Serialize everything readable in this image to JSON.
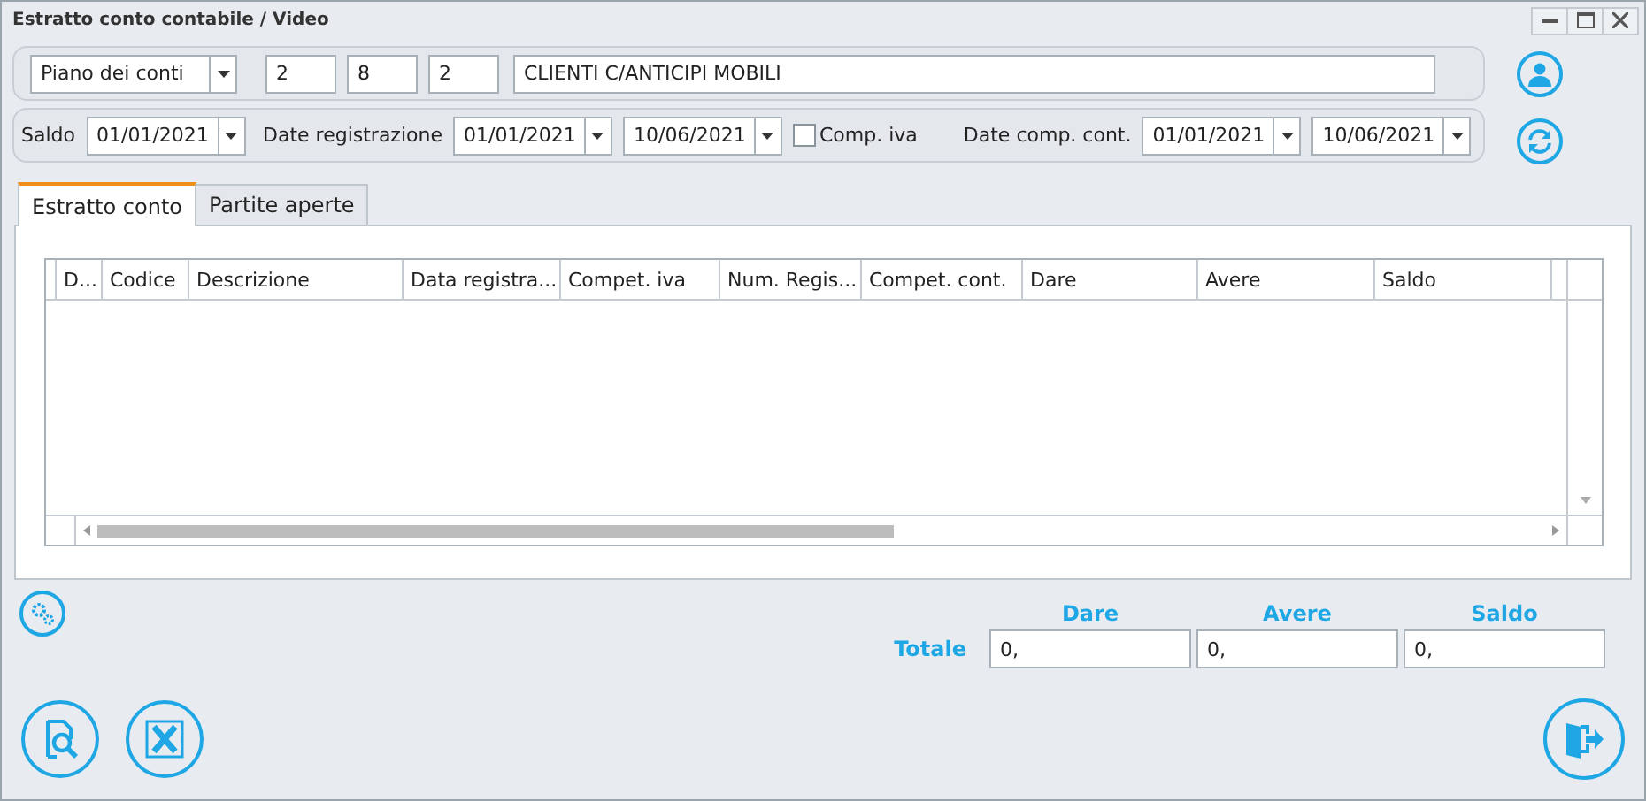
{
  "window": {
    "title": "Estratto conto contabile / Video"
  },
  "account": {
    "type": "Piano dei conti",
    "codes": [
      "2",
      "8",
      "2"
    ],
    "name": "CLIENTI C/ANTICIPI MOBILI"
  },
  "dates": {
    "saldo_label": "Saldo",
    "saldo": "01/01/2021",
    "registration_label": "Date registrazione",
    "registration_from": "01/01/2021",
    "registration_to": "10/06/2021",
    "comp_iva": {
      "label": "Comp. iva",
      "checked": false
    },
    "comp_label": "Date comp. cont.",
    "comp_from": "01/01/2021",
    "comp_to": "10/06/2021"
  },
  "tabs": [
    {
      "label": "Estratto conto",
      "selected": true
    },
    {
      "label": "Partite aperte",
      "selected": false
    }
  ],
  "table": {
    "columns": [
      "D...",
      "Codice",
      "Descrizione",
      "Data registra...",
      "Compet. iva",
      "Num. Regis...",
      "Compet. cont.",
      "Dare",
      "Avere",
      "Saldo"
    ]
  },
  "totals": {
    "label": "Totale",
    "columns": [
      {
        "header": "Dare",
        "value": "0,"
      },
      {
        "header": "Avere",
        "value": "0,"
      },
      {
        "header": "Saldo",
        "value": "0,"
      }
    ]
  }
}
